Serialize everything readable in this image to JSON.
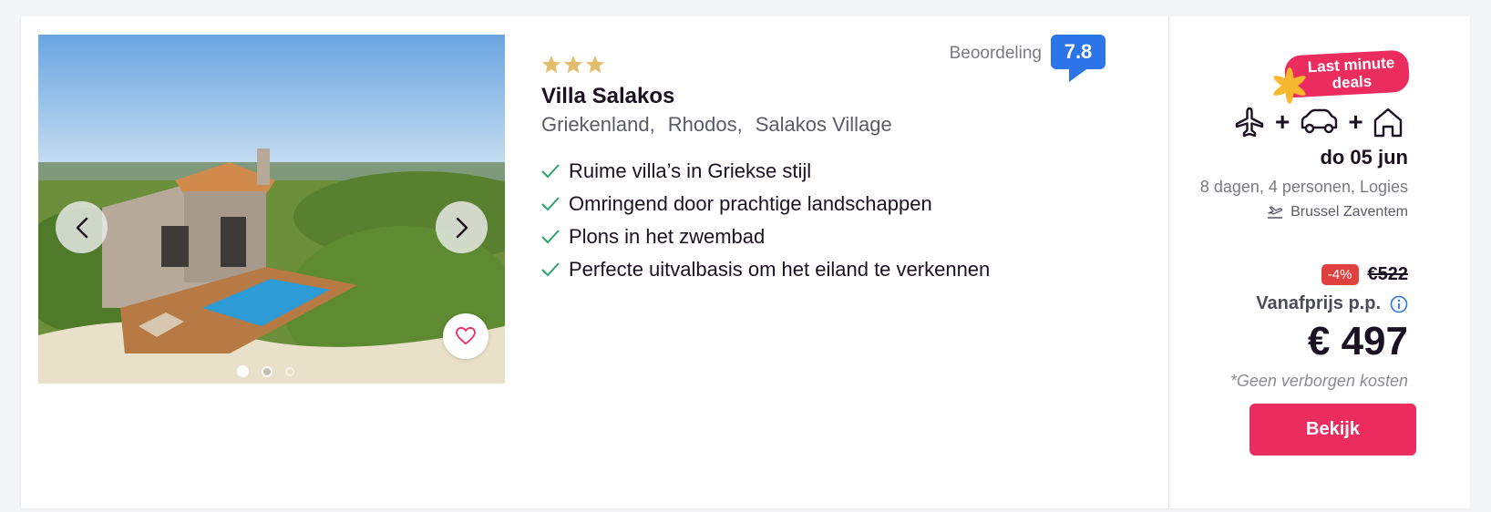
{
  "hotel": {
    "star_count": 3,
    "name": "Villa Salakos",
    "location": [
      "Griekenland,",
      "Rhodos,",
      "Salakos Village"
    ],
    "features": [
      "Ruime villa’s in Griekse stijl",
      "Omringend door prachtige landschappen",
      "Plons in het zwembad",
      "Perfecte uitvalbasis om het eiland te verkennen"
    ]
  },
  "rating": {
    "label": "Beoordeling",
    "score": "7.8"
  },
  "gallery": {
    "slide_count": 3,
    "active_slide": 1
  },
  "deal": {
    "badge": "Last minute deals",
    "transport": [
      "plane-icon",
      "car-icon",
      "home-icon"
    ],
    "date": "do 05 jun",
    "details": "8 dagen, 4 personen, Logies",
    "airport": "Brussel Zaventem",
    "discount": "-4%",
    "old_price": "€522",
    "from_label": "Vanafprijs p.p.",
    "price": "€ 497",
    "no_hidden_costs": "*Geen verborgen kosten",
    "cta_label": "Bekijk"
  },
  "colors": {
    "accent": "#ea2d5e",
    "rating_blue": "#2d74e8",
    "check_green": "#2aa56b",
    "star_gold": "#e3bd6e",
    "discount_red": "#e04040"
  }
}
